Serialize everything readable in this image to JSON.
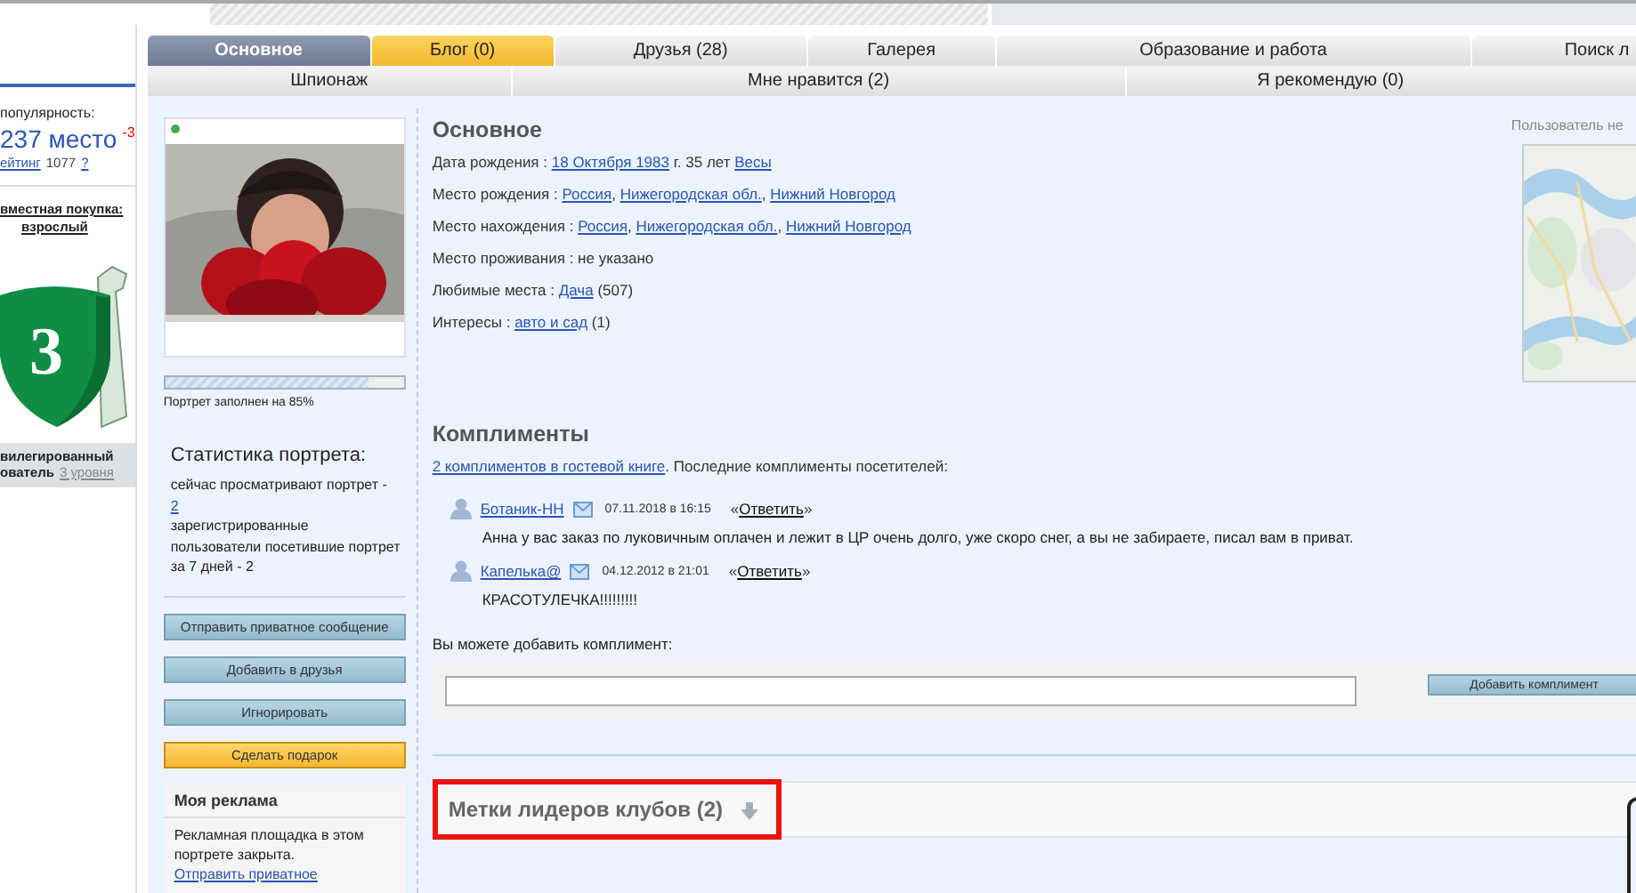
{
  "left_panel": {
    "popularity_label": "популярность:",
    "place": "237 место",
    "place_change": "-3",
    "rating_label": "ейтинг",
    "rating_value": "1077",
    "rating_help": "?",
    "purchase_label": "вместная покупка:",
    "purchase_value": "взрослый",
    "badge_number": "3",
    "status_line_1": "вилегированный",
    "status_line_2": "ователь",
    "status_link": "3 уровня"
  },
  "tabs_row_1": [
    {
      "label": "Основное",
      "selected": true,
      "highlighted": false
    },
    {
      "label": "Блог (0)",
      "selected": false,
      "highlighted": true
    },
    {
      "label": "Друзья (28)",
      "selected": false,
      "highlighted": false
    },
    {
      "label": "Галерея",
      "selected": false,
      "highlighted": false
    },
    {
      "label": "Образование и работа",
      "selected": false,
      "highlighted": false
    },
    {
      "label": "Поиск л",
      "selected": false,
      "highlighted": false
    }
  ],
  "tabs_row_2": [
    {
      "label": "Шпионаж",
      "selected": false
    },
    {
      "label": "Мне нравится (2)",
      "selected": false
    },
    {
      "label": "Я рекомендую (0)",
      "selected": false
    }
  ],
  "profile": {
    "online": true,
    "fill": {
      "level": 0.85
    },
    "fill_text": "Портрет заполнен на 85%"
  },
  "stats": {
    "title": "Статистика портрета:",
    "viewing_text": "сейчас просматривают портрет -",
    "viewing_count": "2",
    "visitors_text": "зарегистрированные пользователи посетившие портрет за 7 дней - 2"
  },
  "actions": [
    {
      "label": "Отправить приватное сообщение",
      "kind": "normal"
    },
    {
      "label": "Добавить в друзья",
      "kind": "normal"
    },
    {
      "label": "Игнорировать",
      "kind": "normal"
    },
    {
      "label": "Сделать подарок",
      "kind": "gift"
    }
  ],
  "ad": {
    "title": "Моя реклама",
    "text": "Рекламная площадка в этом портрете закрыта.",
    "link": "Отправить приватное"
  },
  "about": {
    "title": "Основное",
    "rows": [
      {
        "segments": [
          {
            "text": "Дата рождения : ",
            "link": false
          },
          {
            "text": "18 Октября 1983",
            "link": true
          },
          {
            "text": " г. 35 лет ",
            "link": false
          },
          {
            "text": "Весы",
            "link": true
          }
        ]
      },
      {
        "segments": [
          {
            "text": "Место рождения : ",
            "link": false
          },
          {
            "text": "Россия",
            "link": true
          },
          {
            "text": ", ",
            "link": false
          },
          {
            "text": "Нижегородская обл.",
            "link": true
          },
          {
            "text": ", ",
            "link": false
          },
          {
            "text": "Нижний Новгород",
            "link": true
          }
        ]
      },
      {
        "segments": [
          {
            "text": "Место нахождения : ",
            "link": false
          },
          {
            "text": "Россия",
            "link": true
          },
          {
            "text": ", ",
            "link": false
          },
          {
            "text": "Нижегородская обл.",
            "link": true
          },
          {
            "text": ", ",
            "link": false
          },
          {
            "text": "Нижний Новгород",
            "link": true
          }
        ]
      },
      {
        "segments": [
          {
            "text": "Место проживания : не указано",
            "link": false
          }
        ]
      },
      {
        "segments": [
          {
            "text": "Любимые места : ",
            "link": false
          },
          {
            "text": "Дача",
            "link": true
          },
          {
            "text": " (507)",
            "link": false
          }
        ]
      },
      {
        "segments": [
          {
            "text": "Интересы : ",
            "link": false
          },
          {
            "text": "авто и сад",
            "link": true
          },
          {
            "text": " (1)",
            "link": false
          }
        ]
      }
    ]
  },
  "map": {
    "caption": "Пользователь не",
    "kind": "picture"
  },
  "compliments": {
    "title": "Комплименты",
    "summary_link": "2 комплиментов в гостевой книге",
    "summary_text": ". Последние комплименты посетителей:",
    "items": [
      {
        "author": "Ботаник-НН",
        "date": "07.11.2018 в 16:15",
        "reply_open": "«",
        "reply": "Ответить",
        "reply_close": "»",
        "text": "Анна у вас заказ по луковичным оплачен и лежит в ЦР очень долго, уже скоро снег, а вы не забираете, писал вам в приват."
      },
      {
        "author": "Капелька@",
        "date": "04.12.2012 в 21:01",
        "reply_open": "«",
        "reply": "Ответить",
        "reply_close": "»",
        "text": "КРАСОТУЛЕЧКА!!!!!!!!!"
      }
    ],
    "add_label": "Вы можете добавить комплимент:",
    "add_button": "Добавить комплимент"
  },
  "club_marks": {
    "title": "Метки лидеров клубов (2)",
    "highlighted": true
  }
}
